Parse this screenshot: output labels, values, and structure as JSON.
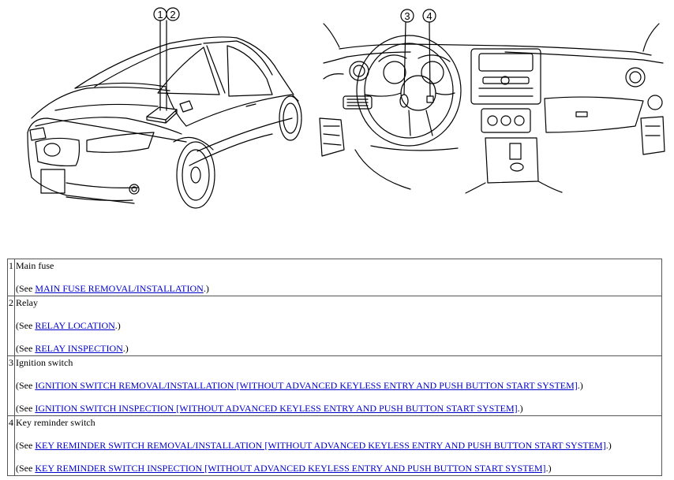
{
  "callouts": [
    "1",
    "2",
    "3",
    "4"
  ],
  "components": [
    {
      "num": "1",
      "name": "Main fuse",
      "refs": [
        {
          "prefix": "(See ",
          "link": "MAIN FUSE REMOVAL/INSTALLATION",
          "suffix": ".)"
        }
      ]
    },
    {
      "num": "2",
      "name": "Relay",
      "refs": [
        {
          "prefix": "(See ",
          "link": "RELAY LOCATION",
          "suffix": ".)"
        },
        {
          "prefix": "(See ",
          "link": "RELAY INSPECTION",
          "suffix": ".)"
        }
      ]
    },
    {
      "num": "3",
      "name": "Ignition switch",
      "refs": [
        {
          "prefix": "(See ",
          "link": "IGNITION SWITCH REMOVAL/INSTALLATION [WITHOUT ADVANCED KEYLESS ENTRY AND PUSH BUTTON START SYSTEM]",
          "suffix": ".)"
        },
        {
          "prefix": "(See ",
          "link": "IGNITION SWITCH INSPECTION [WITHOUT ADVANCED KEYLESS ENTRY AND PUSH BUTTON START SYSTEM]",
          "suffix": ".)"
        }
      ]
    },
    {
      "num": "4",
      "name": "Key reminder switch",
      "refs": [
        {
          "prefix": "(See ",
          "link": "KEY REMINDER SWITCH REMOVAL/INSTALLATION [WITHOUT ADVANCED KEYLESS ENTRY AND PUSH BUTTON START SYSTEM]",
          "suffix": ".)"
        },
        {
          "prefix": "(See ",
          "link": "KEY REMINDER SWITCH INSPECTION [WITHOUT ADVANCED KEYLESS ENTRY AND PUSH BUTTON START SYSTEM]",
          "suffix": ".)"
        }
      ]
    }
  ]
}
